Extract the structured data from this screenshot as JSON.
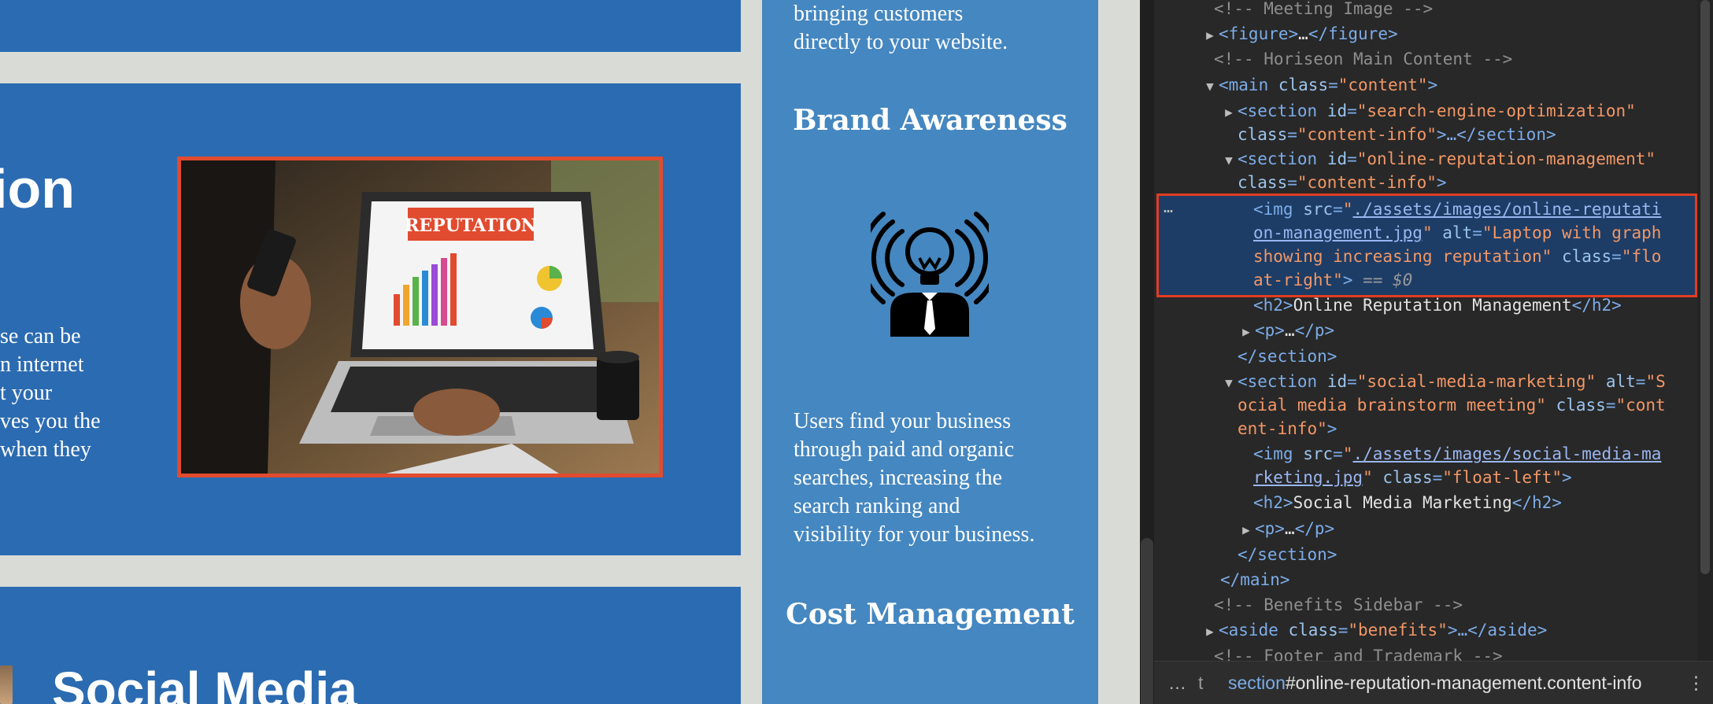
{
  "website": {
    "panels": {
      "orm": {
        "title_fragment": "ion",
        "paragraph_lines": [
          "se can be",
          "n internet",
          "t your",
          "ves you the",
          " when they"
        ]
      },
      "smm": {
        "title_fragment": "Social Media"
      }
    },
    "reputation_image": {
      "label": "REPUTATION",
      "alt": "Laptop with graph showing increasing reputation"
    },
    "sidebar": {
      "lead_lines": [
        "bringing customers",
        "directly to your website."
      ],
      "brand_awareness": {
        "heading": "Brand Awareness",
        "icon": "lightbulb-person-icon",
        "text_lines": [
          "Users find your business",
          "through paid and organic",
          "searches, increasing the",
          "search ranking and",
          "visibility for your business."
        ]
      },
      "cost_management": {
        "heading": "Cost Management"
      }
    }
  },
  "devtools": {
    "colors": {
      "background": "#282828",
      "selected_row": "#1d3d66",
      "highlight_border": "#e23c22"
    },
    "lines": {
      "l01": {
        "comment": "<!-- Meeting Image -->"
      },
      "l02": {
        "open": "<figure>",
        "ellipsis": "…",
        "close": "</figure>"
      },
      "l03": {
        "comment": "<!-- Horiseon Main Content -->"
      },
      "l04": {
        "tag_open": "<main",
        "attr": "class",
        "eq": "=",
        "val": "\"content\"",
        "tag_end": ">"
      },
      "l05": {
        "tag_open": "<section",
        "attr1": "id",
        "val1": "\"search-engine-optimization\""
      },
      "l06": {
        "attr2": "class",
        "val2": "\"content-info\"",
        "tail": ">…</section>"
      },
      "l07": {
        "tag_open": "<section",
        "attr1": "id",
        "val1": "\"online-reputation-management\""
      },
      "l08": {
        "attr2": "class",
        "val2": "\"content-info\"",
        "tag_end": ">"
      },
      "l09": {
        "tag_open": "<img",
        "attr_src": "src",
        "quote": "\"",
        "src_part1": "./assets/images/online-reputati"
      },
      "l10": {
        "src_part2": "on-management.jpg",
        "quote": "\"",
        "attr_alt": "alt",
        "alt_part1": "\"Laptop with graph"
      },
      "l11": {
        "alt_part2": "showing increasing reputation\"",
        "attr_class": "class",
        "class_part1": "\"flo"
      },
      "l12": {
        "class_part2": "at-right\"",
        "tag_end": ">",
        "eq0": "== $0"
      },
      "l13": {
        "open": "<h2>",
        "text": "Online Reputation Management",
        "close": "</h2>"
      },
      "l14": {
        "open": "<p>",
        "ellipsis": "…",
        "close": "</p>"
      },
      "l15": {
        "close": "</section>"
      },
      "l16": {
        "tag_open": "<section",
        "attr1": "id",
        "val1": "\"social-media-marketing\"",
        "attr_alt": "alt",
        "alt_part1": "\"S"
      },
      "l17": {
        "alt_part2": "ocial media brainstorm meeting\"",
        "attr_class": "class",
        "class_part1": "\"cont"
      },
      "l18": {
        "class_part2": "ent-info\"",
        "tag_end": ">"
      },
      "l19": {
        "tag_open": "<img",
        "attr_src": "src",
        "quote": "\"",
        "src_part1": "./assets/images/social-media-ma"
      },
      "l20": {
        "src_part2": "rketing.jpg",
        "quote": "\"",
        "attr_class": "class",
        "class_val": "\"float-left\"",
        "tag_end": ">"
      },
      "l21": {
        "open": "<h2>",
        "text": "Social Media Marketing",
        "close": "</h2>"
      },
      "l22": {
        "open": "<p>",
        "ellipsis": "…",
        "close": "</p>"
      },
      "l23": {
        "close": "</section>"
      },
      "l24": {
        "close": "</main>"
      },
      "l25": {
        "comment": "<!-- Benefits Sidebar -->"
      },
      "l26": {
        "tag_open": "<aside",
        "attr": "class",
        "val": "\"benefits\"",
        "tail": ">…</aside>"
      },
      "l27": {
        "comment": "<!-- Footer and Trademark -->"
      }
    },
    "selected_dots": "…",
    "breadcrumb": {
      "more_left": "…",
      "prev": "t",
      "tag": "section",
      "id": "#online-reputation-management",
      "cls": ".content-info",
      "more_right": "⋮"
    }
  }
}
